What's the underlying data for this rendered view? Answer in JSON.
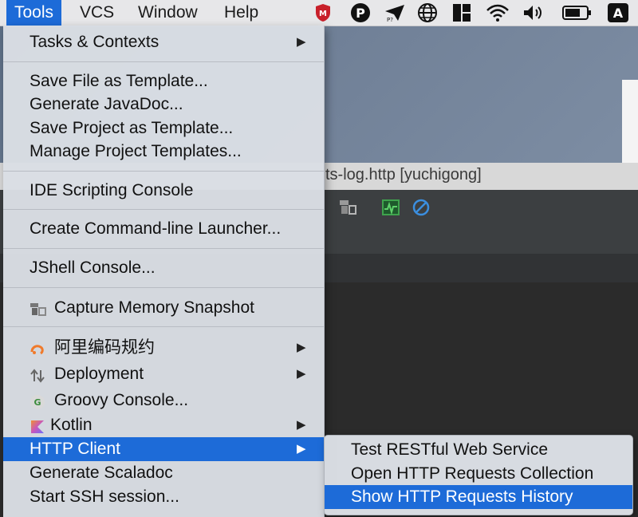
{
  "menubar": {
    "items": [
      "Tools",
      "VCS",
      "Window",
      "Help"
    ],
    "active": "Tools",
    "keyboard_input": "A"
  },
  "ide": {
    "window_title": "ts-log.http [yuchigong]"
  },
  "tools_menu": {
    "items": {
      "tasks": "Tasks & Contexts",
      "save_file_template": "Save File as Template...",
      "generate_javadoc": "Generate JavaDoc...",
      "save_project_template": "Save Project as Template...",
      "manage_project_templates": "Manage Project Templates...",
      "ide_scripting_console": "IDE Scripting Console",
      "create_cmdline_launcher": "Create Command-line Launcher...",
      "jshell_console": "JShell Console...",
      "capture_memory_snapshot": "Capture Memory Snapshot",
      "alibaba_guidelines": "阿里编码规约",
      "deployment": "Deployment",
      "groovy_console": "Groovy Console...",
      "kotlin": "Kotlin",
      "http_client": "HTTP Client",
      "generate_scaladoc": "Generate Scaladoc",
      "start_ssh_session": "Start SSH session..."
    },
    "highlighted": "HTTP Client"
  },
  "http_client_submenu": {
    "items": {
      "test_restful": "Test RESTful Web Service",
      "open_collection": "Open HTTP Requests Collection",
      "show_history": "Show HTTP Requests History"
    },
    "highlighted": "Show HTTP Requests History"
  },
  "colors": {
    "highlight": "#1d6bd8",
    "menu_bg": "#dadee4",
    "menubar_bg": "#e7e7e9"
  }
}
